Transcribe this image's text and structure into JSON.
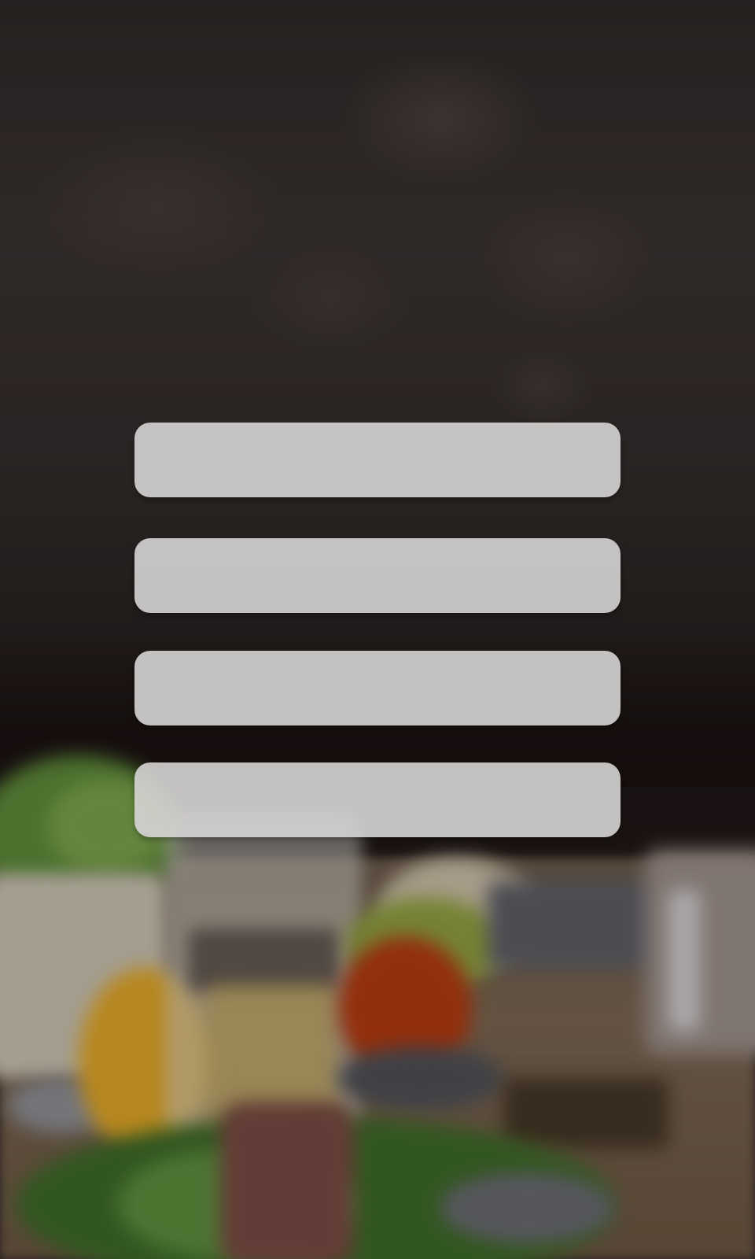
{
  "menu": {
    "buttons": [
      {
        "label": ""
      },
      {
        "label": ""
      },
      {
        "label": ""
      },
      {
        "label": ""
      }
    ]
  }
}
